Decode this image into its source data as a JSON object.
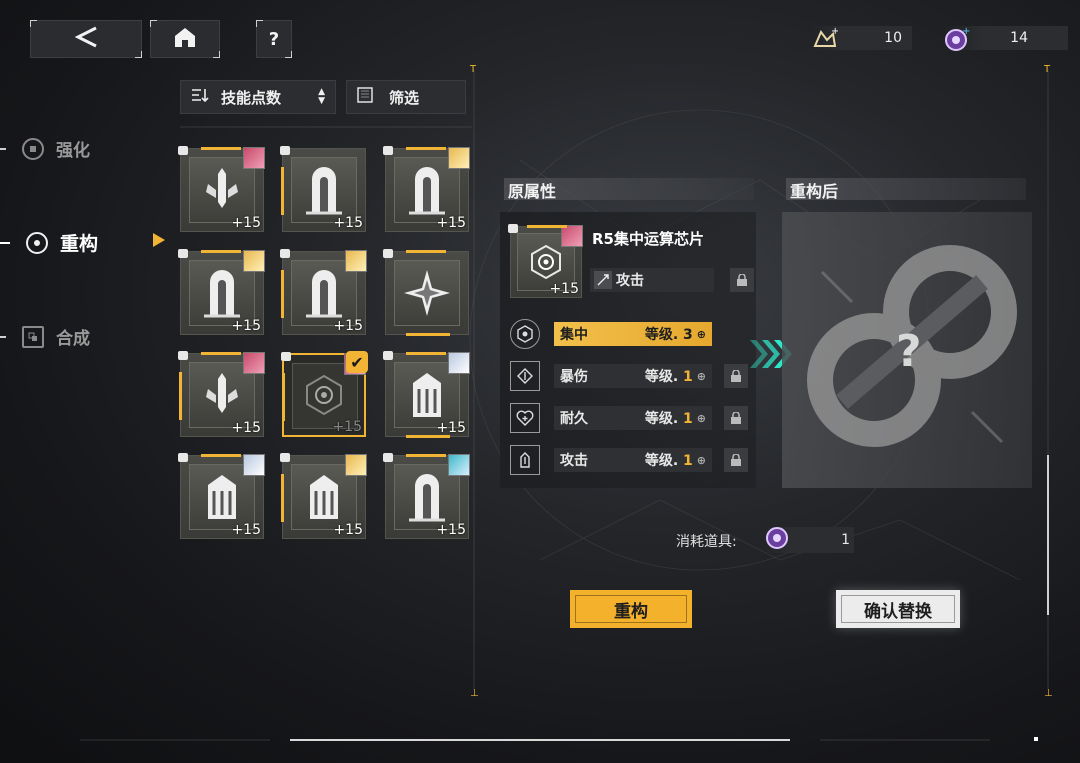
{
  "topbar": {
    "back_icon": "back-arrow-icon",
    "home_icon": "home-icon",
    "help_label": "?",
    "currency1": {
      "icon": "ticket-plus-icon",
      "value": "10"
    },
    "currency2": {
      "icon": "purple-chip-plus-icon",
      "value": "14"
    }
  },
  "nav": {
    "items": [
      {
        "label": "强化",
        "icon": "enhance-icon",
        "active": false
      },
      {
        "label": "重构",
        "icon": "rebuild-icon",
        "active": true
      },
      {
        "label": "合成",
        "icon": "synthesize-icon",
        "active": false
      }
    ]
  },
  "filter": {
    "sort_label": "技能点数",
    "filter_label": "筛选"
  },
  "grid": {
    "cards": [
      {
        "glyph": "sword",
        "level": "+15",
        "avatar": "pink"
      },
      {
        "glyph": "pillar",
        "level": "+15",
        "avatar": ""
      },
      {
        "glyph": "pillar",
        "level": "+15",
        "avatar": "blonde"
      },
      {
        "glyph": "pillar",
        "level": "+15",
        "avatar": "blonde"
      },
      {
        "glyph": "pillar",
        "level": "+15",
        "avatar": "blonde"
      },
      {
        "glyph": "star",
        "level": "",
        "avatar": ""
      },
      {
        "glyph": "sword",
        "level": "+15",
        "avatar": "pink"
      },
      {
        "glyph": "target",
        "level": "+15",
        "avatar": "pink",
        "selected": true
      },
      {
        "glyph": "shield",
        "level": "+15",
        "avatar": "silver"
      },
      {
        "glyph": "shield",
        "level": "+15",
        "avatar": "silver"
      },
      {
        "glyph": "shield",
        "level": "+15",
        "avatar": "blonde"
      },
      {
        "glyph": "pillar",
        "level": "+15",
        "avatar": "teal"
      }
    ]
  },
  "original": {
    "header": "原属性",
    "chip_name": "R5集中运算芯片",
    "chip_level": "+15",
    "main_attr": "攻击",
    "attrs": [
      {
        "name": "集中",
        "level_label": "等级.",
        "level": "3",
        "highlight": true
      },
      {
        "name": "暴伤",
        "level_label": "等级.",
        "level": "1",
        "highlight": false
      },
      {
        "name": "耐久",
        "level_label": "等级.",
        "level": "1",
        "highlight": false
      },
      {
        "name": "攻击",
        "level_label": "等级.",
        "level": "1",
        "highlight": false
      }
    ]
  },
  "result": {
    "header": "重构后",
    "placeholder": "?"
  },
  "consume": {
    "label": "消耗道具:",
    "count": "1"
  },
  "buttons": {
    "rebuild": "重构",
    "confirm": "确认替换"
  },
  "colors": {
    "accent": "#f2b434",
    "teal": "#2ee6c8"
  }
}
